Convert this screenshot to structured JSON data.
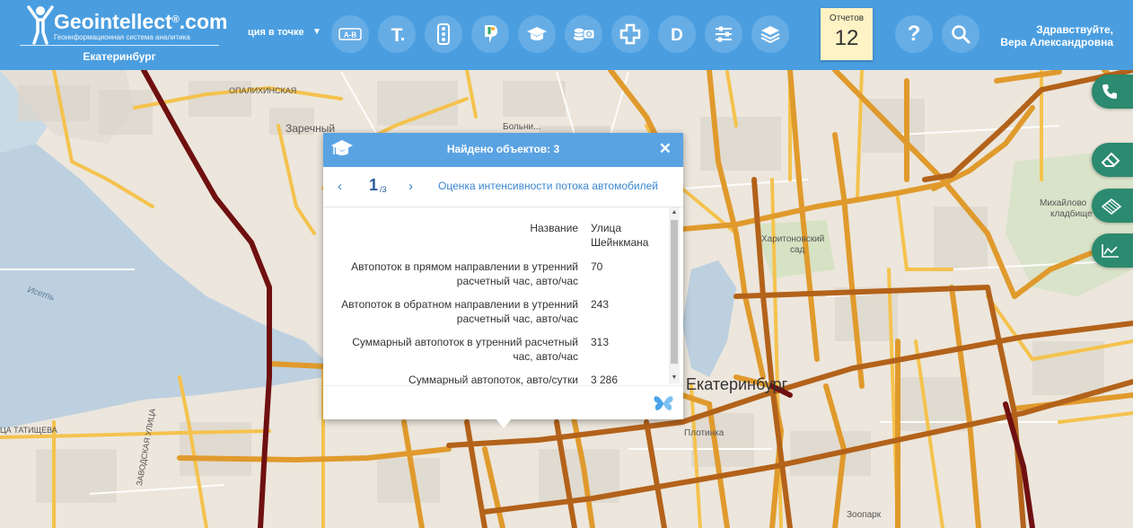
{
  "brand": {
    "title": "Geointellect",
    "title_suffix": ".com",
    "registered": "®",
    "subtitle": "Геоинформационная система аналитика",
    "city": "Екатеринбург"
  },
  "toolbar": {
    "mode_label": "ция в точке",
    "mode_arrow": "▼",
    "buttons": [
      {
        "name": "ab-route",
        "label": "A-B"
      },
      {
        "name": "text-tool",
        "label": "T"
      },
      {
        "name": "traffic-light",
        "label": ""
      },
      {
        "name": "pin-brand",
        "label": ""
      },
      {
        "name": "education",
        "label": ""
      },
      {
        "name": "money",
        "label": ""
      },
      {
        "name": "medical",
        "label": ""
      },
      {
        "name": "d-layer",
        "label": "D"
      },
      {
        "name": "filters",
        "label": ""
      },
      {
        "name": "layers",
        "label": ""
      }
    ],
    "reports_label": "Отчетов",
    "reports_count": "12",
    "help_label": "?",
    "greeting_line1": "Здравствуйте,",
    "greeting_line2": "Вера Александровна"
  },
  "side_tabs": [
    "phone-icon",
    "eraser-icon",
    "map-icon",
    "chart-icon"
  ],
  "popup": {
    "title": "Найдено объектов: 3",
    "close": "✕",
    "prev": "‹",
    "next": "›",
    "current": "1",
    "total": "/3",
    "layer_name": "Оценка интенсивности потока автомобилей",
    "rows": [
      {
        "label": "Название",
        "value": "Улица Шейнкмана"
      },
      {
        "label": "Автопоток в прямом направлении в утренний расчетный час, авто/час",
        "value": "70"
      },
      {
        "label": "Автопоток в обратном направлении в утренний расчетный час, авто/час",
        "value": "243"
      },
      {
        "label": "Суммарный автопоток в утренний расчетный час, авто/час",
        "value": "313"
      },
      {
        "label": "Суммарный автопоток, авто/сутки",
        "value": "3 286"
      }
    ],
    "scroll_up": "▲",
    "scroll_down": "▼"
  },
  "map_labels": {
    "zarechny": "Заречный",
    "bolnichny": "Больни...",
    "opalikhinskaya": "ОПАЛИХИНСКАЯ",
    "iset": "Исеть",
    "kharitonovsky": "Харитоновский",
    "sad": "сад",
    "mikhailovskoe": "Михайлово",
    "kladbishche": "кладбище",
    "ekaterinburg": "Екатеринбург",
    "plotinka": "Плотинка",
    "tatishcheva": "ЦА ТАТИЩЕВА",
    "zoopark": "Зоопарк",
    "zavodskaya": "ЗАВОДСКАЯ УЛИЦА"
  },
  "colors": {
    "header": "#4a9ee0",
    "side_tab": "#2b8a6f",
    "reports_bg": "#fdf3c5",
    "popup_head": "#5aa3e3",
    "road_dark": "#6b0e0e",
    "road_brown": "#a6520f",
    "road_orange": "#d98a1f",
    "road_yellow": "#f2b23c"
  }
}
